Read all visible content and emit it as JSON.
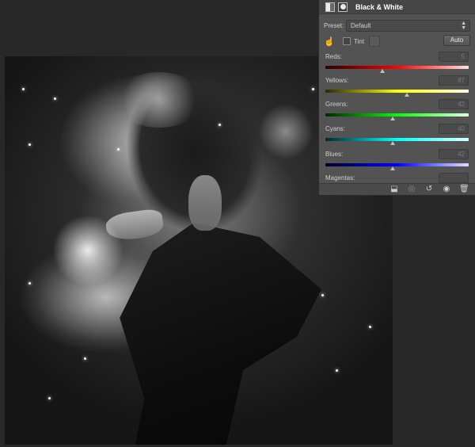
{
  "panel": {
    "title": "Black & White",
    "icons": {
      "adjustment": "black-white-adjustment-icon",
      "mask": "layer-mask-icon"
    },
    "preset": {
      "label": "Preset:",
      "value": "Default"
    },
    "tint": {
      "label": "Tint",
      "checked": false
    },
    "auto_label": "Auto",
    "hand_tool_icon": "targeted-adjustment-hand-icon",
    "sliders": [
      {
        "name": "Reds:",
        "value": "5",
        "level": 0.4
      },
      {
        "name": "Yellows:",
        "value": "87",
        "level": 0.57
      },
      {
        "name": "Greens:",
        "value": "42",
        "level": 0.47
      },
      {
        "name": "Cyans:",
        "value": "40",
        "level": 0.47
      },
      {
        "name": "Blues:",
        "value": "42",
        "level": 0.47
      },
      {
        "name": "Magentas:",
        "value": ""
      }
    ],
    "footer_icons": [
      "clip-to-layer-icon",
      "view-previous-state-icon",
      "reset-icon",
      "visibility-eye-icon",
      "trash-icon"
    ]
  },
  "colors": {
    "app_background": "#282828",
    "panel_background": "#535353"
  }
}
